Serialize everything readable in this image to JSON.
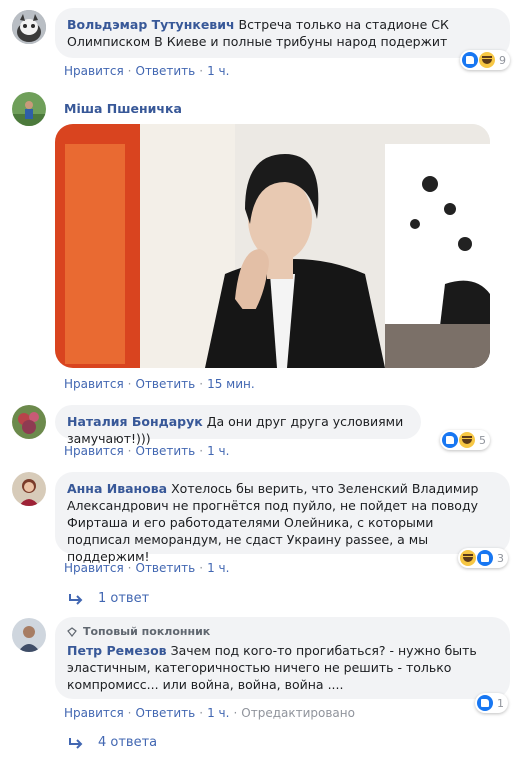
{
  "comments": [
    {
      "author": "Вольдэмар Тутункевич",
      "text": "Встреча только на стадионе СК Олимписком В Киеве и полные трибуны народ подержит",
      "like": "Нравится",
      "reply": "Ответить",
      "time": "1 ч.",
      "reaction_count": "9"
    },
    {
      "author": "Міша Пшеничка",
      "like": "Нравится",
      "reply": "Ответить",
      "time": "15 мин."
    },
    {
      "author": "Наталия Бондарук",
      "text": "Да они друг друга условиями замучают!)))",
      "like": "Нравится",
      "reply": "Ответить",
      "time": "1 ч.",
      "reaction_count": "5"
    },
    {
      "author": "Анна Иванова",
      "text": "Хотелось бы верить, что Зеленский Владимир Александрович не прогнётся под пуйло, не пойдет на поводу Фирташа и его работодателями Олейника, с которыми подписал меморандум, не сдаст Украину passee, а мы поддержим!",
      "like": "Нравится",
      "reply": "Ответить",
      "time": "1 ч.",
      "reaction_count": "3",
      "replies": "1 ответ"
    },
    {
      "badge": "Топовый поклонник",
      "author": "Петр Ремезов",
      "text": "Зачем под кого-то прогибаться? - нужно быть эластичным, категоричностью ничего не решить - только компромисс... или война, война, война ....",
      "like": "Нравится",
      "reply": "Ответить",
      "time": "1 ч.",
      "edited": "Отредактировано",
      "reaction_count": "1",
      "replies": "4 ответа"
    }
  ]
}
